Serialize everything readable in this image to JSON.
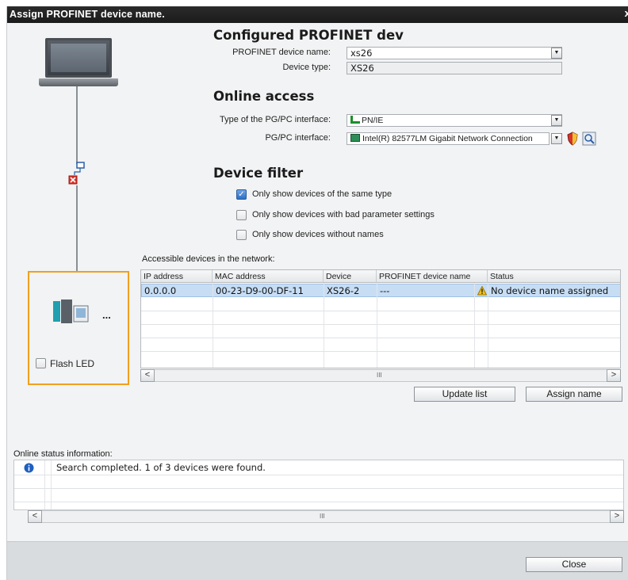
{
  "dialog": {
    "title": "Assign PROFINET device name.",
    "close_glyph": "x"
  },
  "configured": {
    "heading": "Configured PROFINET dev",
    "device_name_label": "PROFINET device name:",
    "device_name_value": "xs26",
    "device_type_label": "Device type:",
    "device_type_value": "XS26"
  },
  "online_access": {
    "heading": "Online access",
    "interface_type_label": "Type of the PG/PC interface:",
    "interface_type_value": "PN/IE",
    "interface_label": "PG/PC interface:",
    "interface_value": "Intel(R) 82577LM Gigabit Network Connection"
  },
  "device_filter": {
    "heading": "Device filter",
    "options": [
      {
        "label": "Only show devices of the same type",
        "checked": true
      },
      {
        "label": "Only show devices with bad parameter settings",
        "checked": false
      },
      {
        "label": "Only show devices without names",
        "checked": false
      }
    ]
  },
  "left_panel": {
    "flash_led_label": "Flash LED",
    "device_dots": "..."
  },
  "devices": {
    "caption": "Accessible devices in the network:",
    "columns": [
      "IP address",
      "MAC address",
      "Device",
      "PROFINET device name",
      "Status"
    ],
    "rows": [
      {
        "ip": "0.0.0.0",
        "mac": "00-23-D9-00-DF-11",
        "device": "XS26-2",
        "name": "---",
        "status": "No device name assigned",
        "status_icon": "warning-icon"
      }
    ]
  },
  "buttons": {
    "update_list": "Update list",
    "assign_name": "Assign name",
    "close": "Close"
  },
  "status_info": {
    "caption": "Online status information:",
    "messages": [
      {
        "icon": "info-icon",
        "text": "Search completed. 1 of 3 devices were found."
      }
    ]
  },
  "scroll_mark": "III",
  "colors": {
    "selected_row": "#c7ddf4",
    "device_box": "#f0a020",
    "title_bar": "#1f1f1f"
  }
}
